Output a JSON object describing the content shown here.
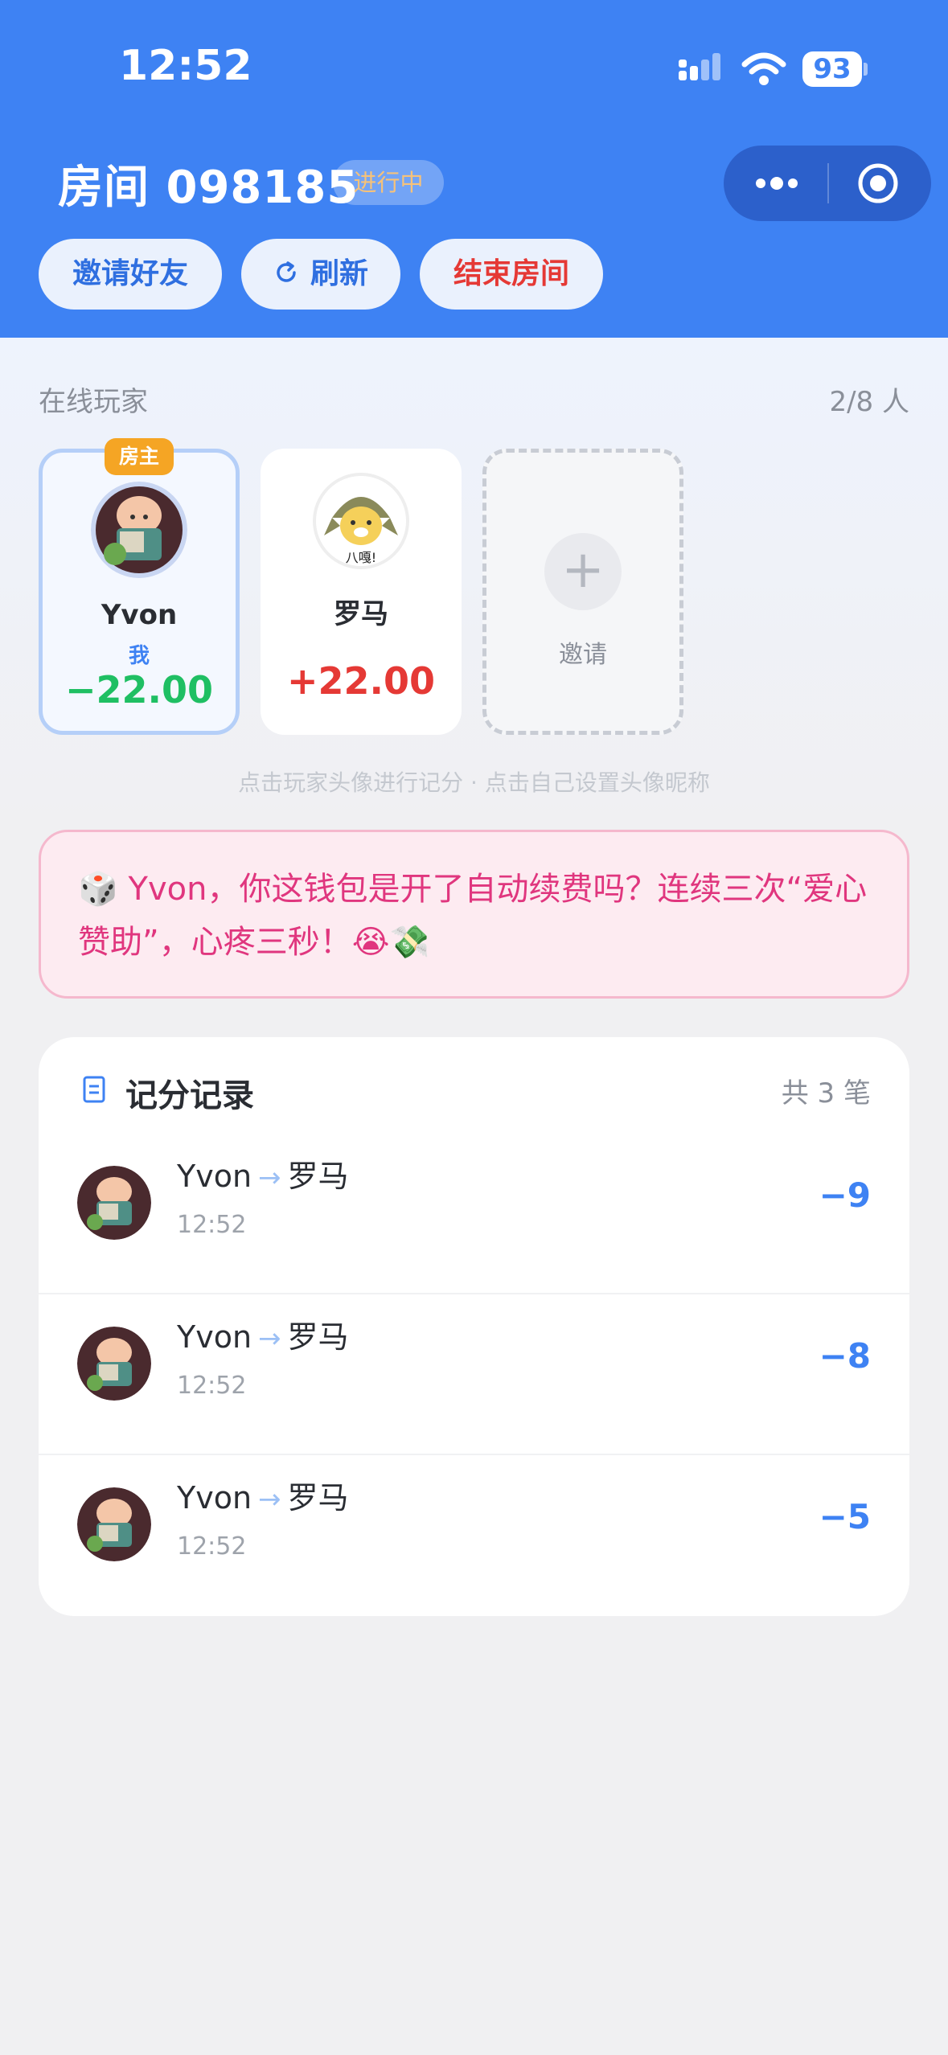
{
  "status_bar": {
    "time": "12:52",
    "battery": "93"
  },
  "header": {
    "room_title": "房间 098185",
    "status": "进行中",
    "buttons": {
      "invite": "邀请好友",
      "refresh": "刷新",
      "end": "结束房间"
    }
  },
  "players_section": {
    "label": "在线玩家",
    "count": "2/8 人",
    "host_badge": "房主",
    "players": [
      {
        "name": "Yvon",
        "me_label": "我",
        "score": "−22.00"
      },
      {
        "name": "罗马",
        "score": "+22.00",
        "avatar_caption": "八嘎!"
      }
    ],
    "invite_label": "邀请",
    "hint": "点击玩家头像进行记分 · 点击自己设置头像昵称"
  },
  "message": {
    "text": "🎲 Yvon，你这钱包是开了自动续费吗？连续三次“爱心赞助”，心疼三秒！😭💸"
  },
  "records": {
    "title": "记分记录",
    "count": "共 3 笔",
    "items": [
      {
        "from": "Yvon",
        "to": "罗马",
        "time": "12:52",
        "amount": "−9"
      },
      {
        "from": "Yvon",
        "to": "罗马",
        "time": "12:52",
        "amount": "−8"
      },
      {
        "from": "Yvon",
        "to": "罗马",
        "time": "12:52",
        "amount": "−5"
      }
    ]
  },
  "colors": {
    "header_bg": "#3e82f3",
    "score_negative": "#1fbf63",
    "score_positive": "#e53935",
    "host_badge": "#f5a524",
    "message_text": "#e0367e"
  }
}
